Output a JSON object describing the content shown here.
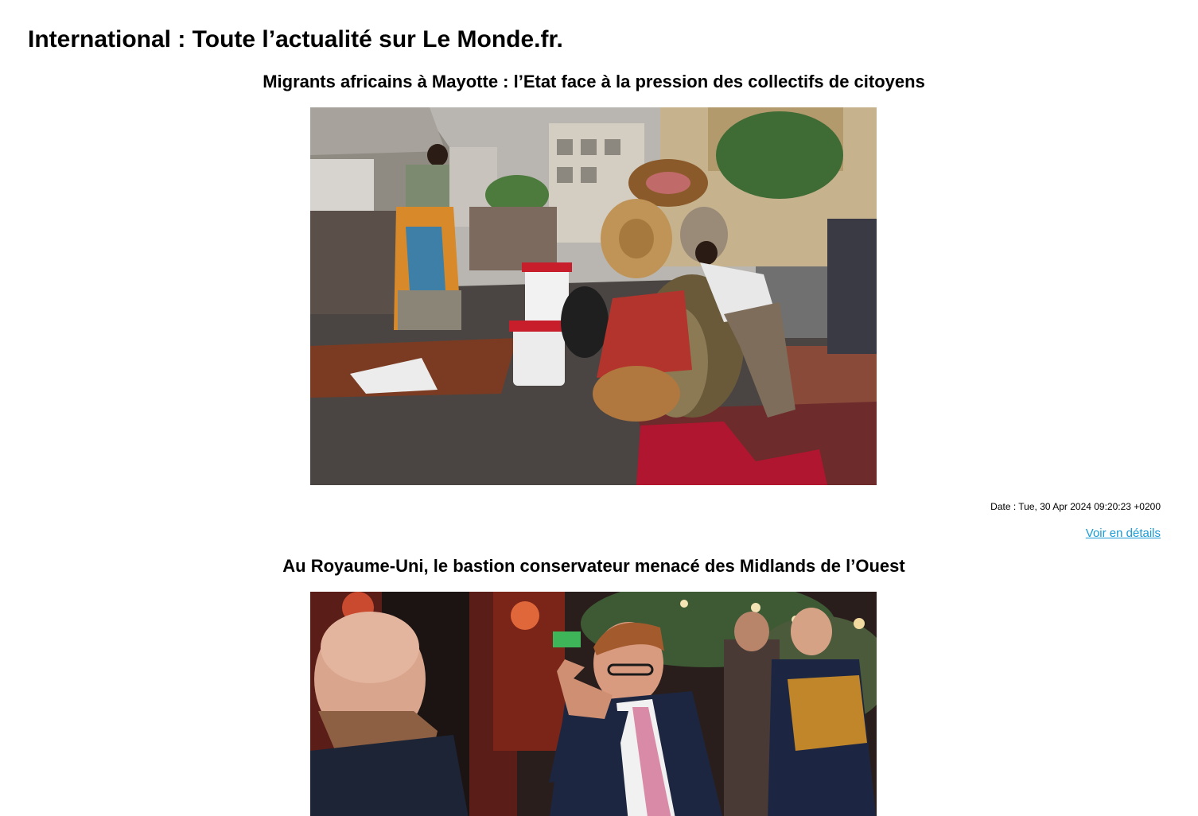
{
  "page": {
    "title": "International : Toute l’actualité sur Le Monde.fr."
  },
  "articles": [
    {
      "title": "Migrants africains à Mayotte : l’Etat face à la pression des collectifs de citoyens",
      "date": "Date : Tue, 30 Apr 2024 09:20:23 +0200",
      "link_label": "Voir en détails",
      "image_subject": "street-encampment-photo"
    },
    {
      "title": "Au Royaume-Uni, le bastion conservateur menacé des Midlands de l’Ouest",
      "image_subject": "politician-pointing-photo"
    }
  ]
}
